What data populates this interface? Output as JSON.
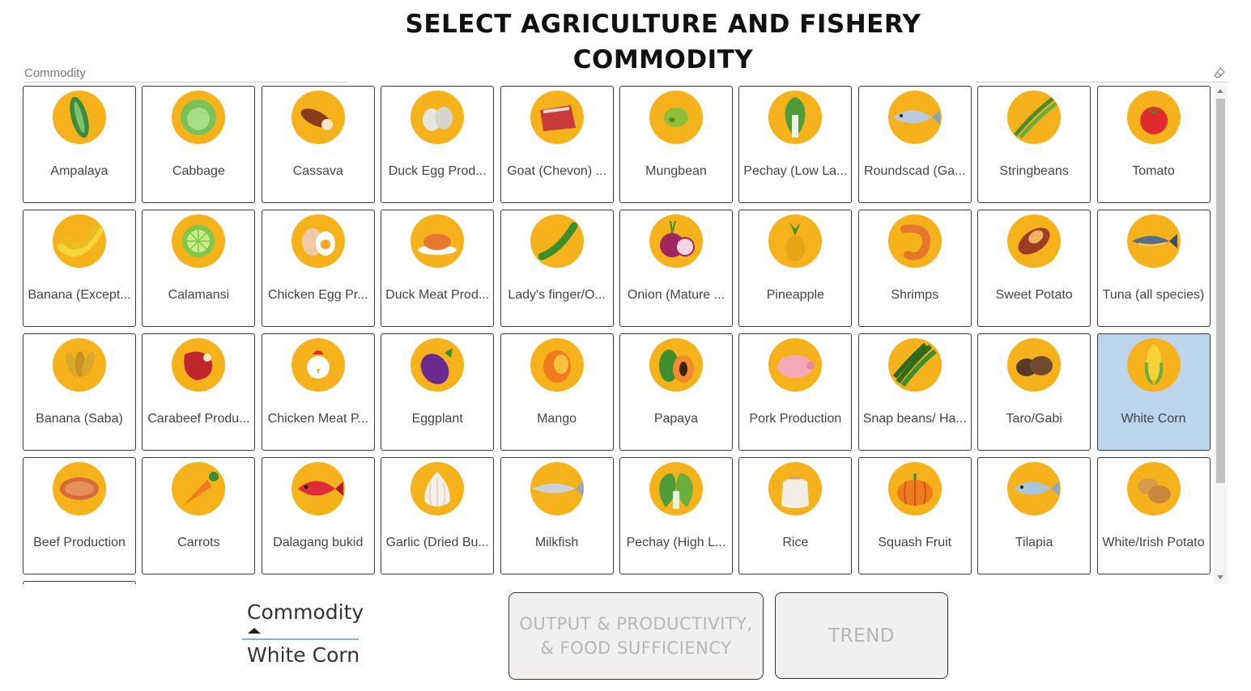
{
  "title": {
    "line1": "SELECT AGRICULTURE AND FISHERY",
    "line2": "COMMODITY"
  },
  "slicer": {
    "header": "Commodity",
    "eraser_icon": "eraser-icon",
    "selected": "White Corn",
    "items": [
      {
        "label": "Ampalaya",
        "icon": "bitter-gourd-icon"
      },
      {
        "label": "Cabbage",
        "icon": "cabbage-icon"
      },
      {
        "label": "Cassava",
        "icon": "cassava-icon"
      },
      {
        "label": "Duck Egg Prod...",
        "icon": "duck-egg-icon"
      },
      {
        "label": "Goat (Chevon) ...",
        "icon": "goat-meat-icon"
      },
      {
        "label": "Mungbean",
        "icon": "mungbean-icon"
      },
      {
        "label": "Pechay (Low La...",
        "icon": "pechay-icon"
      },
      {
        "label": "Roundscad (Ga...",
        "icon": "roundscad-fish-icon"
      },
      {
        "label": "Stringbeans",
        "icon": "stringbeans-icon"
      },
      {
        "label": "Tomato",
        "icon": "tomato-icon"
      },
      {
        "label": "Banana (Except...",
        "icon": "banana-icon"
      },
      {
        "label": "Calamansi",
        "icon": "calamansi-icon"
      },
      {
        "label": "Chicken Egg Pr...",
        "icon": "chicken-egg-icon"
      },
      {
        "label": "Duck Meat Prod...",
        "icon": "duck-meat-icon"
      },
      {
        "label": "Lady's finger/O...",
        "icon": "okra-icon"
      },
      {
        "label": "Onion (Mature ...",
        "icon": "onion-icon"
      },
      {
        "label": "Pineapple",
        "icon": "pineapple-icon"
      },
      {
        "label": "Shrimps",
        "icon": "shrimp-icon"
      },
      {
        "label": "Sweet Potato",
        "icon": "sweet-potato-icon"
      },
      {
        "label": "Tuna (all species)",
        "icon": "tuna-icon"
      },
      {
        "label": "Banana (Saba)",
        "icon": "saba-banana-icon"
      },
      {
        "label": "Carabeef Produ...",
        "icon": "carabeef-icon"
      },
      {
        "label": "Chicken Meat P...",
        "icon": "chicken-icon"
      },
      {
        "label": "Eggplant",
        "icon": "eggplant-icon"
      },
      {
        "label": "Mango",
        "icon": "mango-icon"
      },
      {
        "label": "Papaya",
        "icon": "papaya-icon"
      },
      {
        "label": "Pork Production",
        "icon": "pig-icon"
      },
      {
        "label": "Snap beans/ Ha...",
        "icon": "snap-beans-icon"
      },
      {
        "label": "Taro/Gabi",
        "icon": "taro-icon"
      },
      {
        "label": "White Corn",
        "icon": "corn-icon"
      },
      {
        "label": "Beef Production",
        "icon": "beef-icon"
      },
      {
        "label": "Carrots",
        "icon": "carrot-icon"
      },
      {
        "label": "Dalagang bukid",
        "icon": "red-fish-icon"
      },
      {
        "label": "Garlic (Dried Bu...",
        "icon": "garlic-icon"
      },
      {
        "label": "Milkfish",
        "icon": "milkfish-icon"
      },
      {
        "label": "Pechay (High L...",
        "icon": "pechay-highland-icon"
      },
      {
        "label": "Rice",
        "icon": "rice-sack-icon"
      },
      {
        "label": "Squash Fruit",
        "icon": "squash-icon"
      },
      {
        "label": "Tilapia",
        "icon": "tilapia-icon"
      },
      {
        "label": "White/Irish Potato",
        "icon": "potato-icon"
      }
    ]
  },
  "card": {
    "label": "Commodity",
    "value": "White Corn"
  },
  "buttons": {
    "output": "OUTPUT & PRODUCTIVITY, & FOOD SUFFICIENCY",
    "trend": "TREND"
  },
  "colors": {
    "icon_circle": "#f6b21b",
    "selected_tile": "#bcd5ec",
    "button_bg": "#f1f0ee",
    "button_text": "#b8b6b2"
  }
}
